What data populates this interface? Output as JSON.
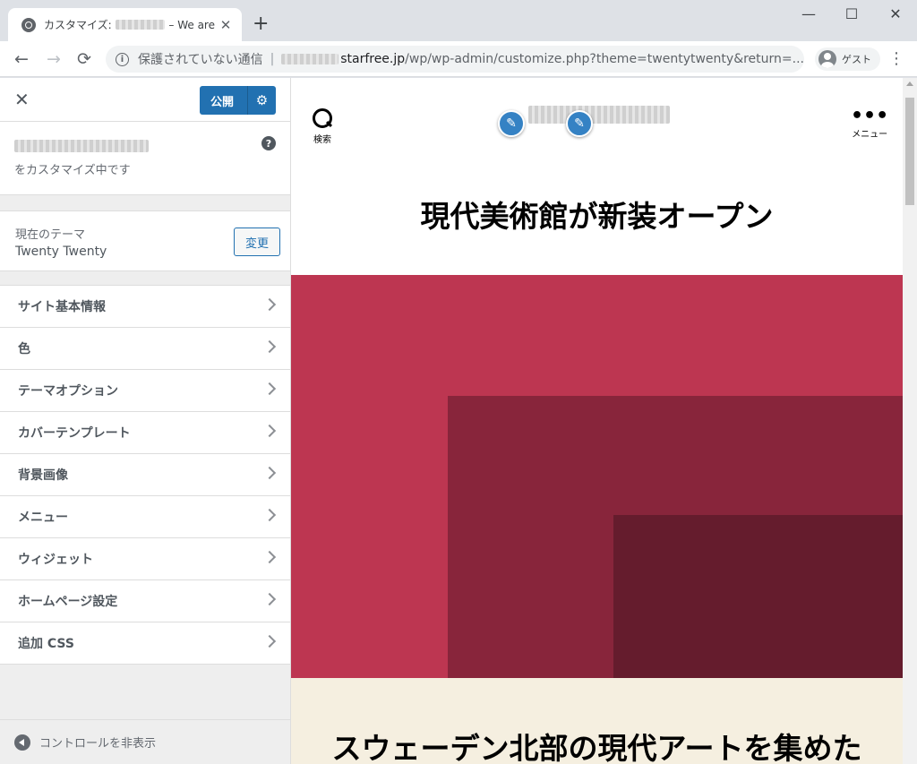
{
  "browser": {
    "tab": {
      "title_prefix": "カスタマイズ:",
      "title_suffix": "– We are",
      "close": "✕"
    },
    "new_tab": "+",
    "window_controls": {
      "minimize": "—",
      "maximize": "☐",
      "close": "✕"
    },
    "nav": {
      "back": "←",
      "forward": "→",
      "reload": "⟳"
    },
    "omnibox": {
      "security_text": "保護されていない通信",
      "separator": "|",
      "url_host": "starfree.jp",
      "url_path": "/wp/wp-admin/customize.php?theme=twentytwenty&return=..."
    },
    "guest_label": "ゲスト",
    "menu": "⋮"
  },
  "customizer": {
    "close": "✕",
    "publish_label": "公開",
    "publish_gear": "⚙",
    "help": "?",
    "customizing_text": "をカスタマイズ中です",
    "theme": {
      "caption": "現在のテーマ",
      "name": "Twenty Twenty",
      "change_label": "変更"
    },
    "sections": [
      {
        "label": "サイト基本情報"
      },
      {
        "label": "色"
      },
      {
        "label": "テーマオプション"
      },
      {
        "label": "カバーテンプレート"
      },
      {
        "label": "背景画像"
      },
      {
        "label": "メニュー"
      },
      {
        "label": "ウィジェット"
      },
      {
        "label": "ホームページ設定"
      },
      {
        "label": "追加 CSS"
      }
    ],
    "footer_label": "コントロールを非表示"
  },
  "preview": {
    "search_label": "検索",
    "menu_label": "メニュー",
    "menu_dots": "•••",
    "pencil": "✎",
    "post_title": "現代美術館が新装オープン",
    "cover_heading": "スウェーデン北部の現代アートを集めた"
  },
  "colors": {
    "publish_blue": "#2271b1",
    "cover_red": "#bd3651",
    "cover_mid": "#88253b",
    "cover_dark": "#651c2d",
    "cream": "#f5efe0"
  }
}
